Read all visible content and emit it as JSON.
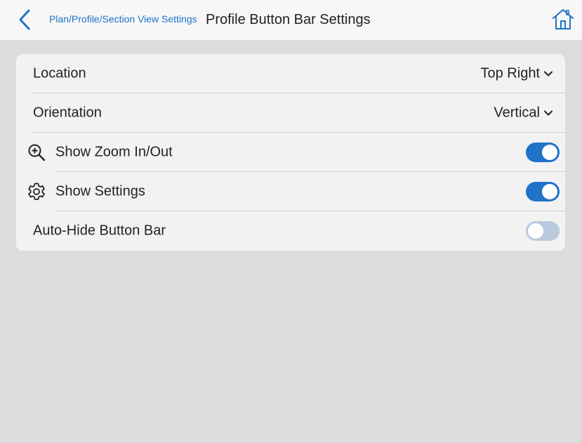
{
  "header": {
    "back_icon": "chevron-left-icon",
    "breadcrumb": "Plan/Profile/Section View Settings",
    "title": "Profile Button Bar Settings",
    "home_icon": "home-icon",
    "accent_color": "#1f73c8"
  },
  "settings": {
    "location": {
      "label": "Location",
      "value": "Top Right"
    },
    "orientation": {
      "label": "Orientation",
      "value": "Vertical"
    },
    "zoom": {
      "label": "Show Zoom In/Out",
      "icon": "zoom-in-icon",
      "enabled": true
    },
    "show_settings": {
      "label": "Show Settings",
      "icon": "gear-icon",
      "enabled": true
    },
    "auto_hide": {
      "label": "Auto-Hide Button Bar",
      "enabled": false
    }
  }
}
